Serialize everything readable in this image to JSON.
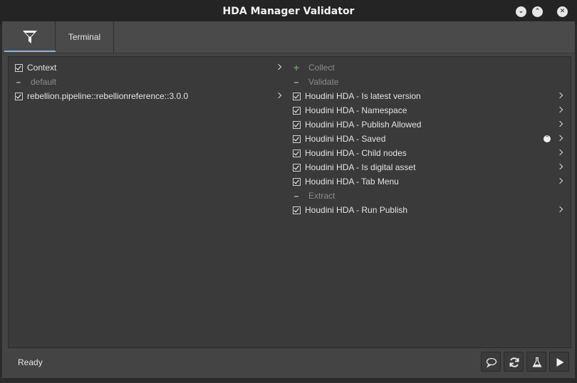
{
  "window": {
    "title": "HDA Manager Validator",
    "controls": {
      "minimize": "⌄",
      "maximize": "⌃",
      "close": "✕"
    }
  },
  "tabs": {
    "filter_icon": "filter-icon",
    "terminal_label": "Terminal"
  },
  "left": {
    "context_label": "Context",
    "default_label": "default",
    "instance_label": "rebellion.pipeline::rebellionreference::3.0.0"
  },
  "right": {
    "collect_label": "Collect",
    "validate_label": "Validate",
    "extract_label": "Extract",
    "validators": [
      {
        "label": "Houdini HDA - Is latest version",
        "checked": true
      },
      {
        "label": "Houdini HDA - Namespace",
        "checked": true
      },
      {
        "label": "Houdini HDA - Publish Allowed",
        "checked": true
      },
      {
        "label": "Houdini HDA - Saved",
        "checked": true,
        "status": "^"
      },
      {
        "label": "Houdini HDA - Child nodes",
        "checked": true
      },
      {
        "label": "Houdini HDA - Is digital asset",
        "checked": true
      },
      {
        "label": "Houdini HDA - Tab Menu",
        "checked": true
      }
    ],
    "extractors": [
      {
        "label": "Houdini HDA - Run Publish",
        "checked": true
      }
    ]
  },
  "footer": {
    "status": "Ready",
    "buttons": [
      "comment-icon",
      "reset-icon",
      "flask-icon",
      "play-icon"
    ]
  },
  "colors": {
    "accent_underline": "#8fb2d3",
    "collect_plus": "#5aa64a"
  }
}
